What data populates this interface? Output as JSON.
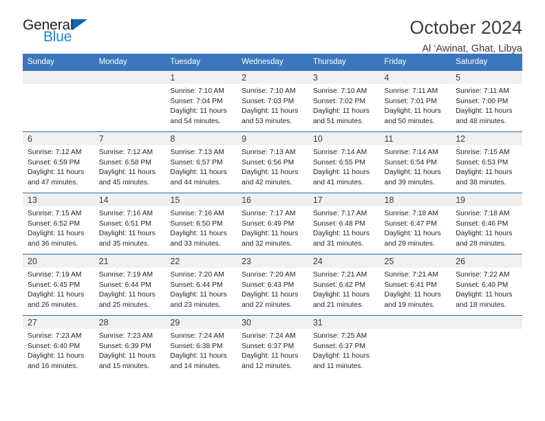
{
  "brand": {
    "name_part1": "General",
    "name_part2": "Blue",
    "flag_color": "#0b68b3",
    "text_color": "#1f85d0"
  },
  "header": {
    "title": "October 2024",
    "location": "Al ‘Awinat, Ghat, Libya"
  },
  "theme": {
    "header_bg": "#3b77bd",
    "row_border": "#1f6cb0",
    "daynum_bg": "#f0f0f0"
  },
  "weekday_headers": [
    "Sunday",
    "Monday",
    "Tuesday",
    "Wednesday",
    "Thursday",
    "Friday",
    "Saturday"
  ],
  "labels": {
    "sunrise_prefix": "Sunrise:",
    "sunset_prefix": "Sunset:",
    "daylight_prefix": "Daylight:"
  },
  "weeks": [
    [
      {
        "day": "",
        "sunrise": "",
        "sunset": "",
        "daylight_line1": "",
        "daylight_line2": ""
      },
      {
        "day": "",
        "sunrise": "",
        "sunset": "",
        "daylight_line1": "",
        "daylight_line2": ""
      },
      {
        "day": "1",
        "sunrise": "Sunrise: 7:10 AM",
        "sunset": "Sunset: 7:04 PM",
        "daylight_line1": "Daylight: 11 hours",
        "daylight_line2": "and 54 minutes."
      },
      {
        "day": "2",
        "sunrise": "Sunrise: 7:10 AM",
        "sunset": "Sunset: 7:03 PM",
        "daylight_line1": "Daylight: 11 hours",
        "daylight_line2": "and 53 minutes."
      },
      {
        "day": "3",
        "sunrise": "Sunrise: 7:10 AM",
        "sunset": "Sunset: 7:02 PM",
        "daylight_line1": "Daylight: 11 hours",
        "daylight_line2": "and 51 minutes."
      },
      {
        "day": "4",
        "sunrise": "Sunrise: 7:11 AM",
        "sunset": "Sunset: 7:01 PM",
        "daylight_line1": "Daylight: 11 hours",
        "daylight_line2": "and 50 minutes."
      },
      {
        "day": "5",
        "sunrise": "Sunrise: 7:11 AM",
        "sunset": "Sunset: 7:00 PM",
        "daylight_line1": "Daylight: 11 hours",
        "daylight_line2": "and 48 minutes."
      }
    ],
    [
      {
        "day": "6",
        "sunrise": "Sunrise: 7:12 AM",
        "sunset": "Sunset: 6:59 PM",
        "daylight_line1": "Daylight: 11 hours",
        "daylight_line2": "and 47 minutes."
      },
      {
        "day": "7",
        "sunrise": "Sunrise: 7:12 AM",
        "sunset": "Sunset: 6:58 PM",
        "daylight_line1": "Daylight: 11 hours",
        "daylight_line2": "and 45 minutes."
      },
      {
        "day": "8",
        "sunrise": "Sunrise: 7:13 AM",
        "sunset": "Sunset: 6:57 PM",
        "daylight_line1": "Daylight: 11 hours",
        "daylight_line2": "and 44 minutes."
      },
      {
        "day": "9",
        "sunrise": "Sunrise: 7:13 AM",
        "sunset": "Sunset: 6:56 PM",
        "daylight_line1": "Daylight: 11 hours",
        "daylight_line2": "and 42 minutes."
      },
      {
        "day": "10",
        "sunrise": "Sunrise: 7:14 AM",
        "sunset": "Sunset: 6:55 PM",
        "daylight_line1": "Daylight: 11 hours",
        "daylight_line2": "and 41 minutes."
      },
      {
        "day": "11",
        "sunrise": "Sunrise: 7:14 AM",
        "sunset": "Sunset: 6:54 PM",
        "daylight_line1": "Daylight: 11 hours",
        "daylight_line2": "and 39 minutes."
      },
      {
        "day": "12",
        "sunrise": "Sunrise: 7:15 AM",
        "sunset": "Sunset: 6:53 PM",
        "daylight_line1": "Daylight: 11 hours",
        "daylight_line2": "and 38 minutes."
      }
    ],
    [
      {
        "day": "13",
        "sunrise": "Sunrise: 7:15 AM",
        "sunset": "Sunset: 6:52 PM",
        "daylight_line1": "Daylight: 11 hours",
        "daylight_line2": "and 36 minutes."
      },
      {
        "day": "14",
        "sunrise": "Sunrise: 7:16 AM",
        "sunset": "Sunset: 6:51 PM",
        "daylight_line1": "Daylight: 11 hours",
        "daylight_line2": "and 35 minutes."
      },
      {
        "day": "15",
        "sunrise": "Sunrise: 7:16 AM",
        "sunset": "Sunset: 6:50 PM",
        "daylight_line1": "Daylight: 11 hours",
        "daylight_line2": "and 33 minutes."
      },
      {
        "day": "16",
        "sunrise": "Sunrise: 7:17 AM",
        "sunset": "Sunset: 6:49 PM",
        "daylight_line1": "Daylight: 11 hours",
        "daylight_line2": "and 32 minutes."
      },
      {
        "day": "17",
        "sunrise": "Sunrise: 7:17 AM",
        "sunset": "Sunset: 6:48 PM",
        "daylight_line1": "Daylight: 11 hours",
        "daylight_line2": "and 31 minutes."
      },
      {
        "day": "18",
        "sunrise": "Sunrise: 7:18 AM",
        "sunset": "Sunset: 6:47 PM",
        "daylight_line1": "Daylight: 11 hours",
        "daylight_line2": "and 29 minutes."
      },
      {
        "day": "19",
        "sunrise": "Sunrise: 7:18 AM",
        "sunset": "Sunset: 6:46 PM",
        "daylight_line1": "Daylight: 11 hours",
        "daylight_line2": "and 28 minutes."
      }
    ],
    [
      {
        "day": "20",
        "sunrise": "Sunrise: 7:19 AM",
        "sunset": "Sunset: 6:45 PM",
        "daylight_line1": "Daylight: 11 hours",
        "daylight_line2": "and 26 minutes."
      },
      {
        "day": "21",
        "sunrise": "Sunrise: 7:19 AM",
        "sunset": "Sunset: 6:44 PM",
        "daylight_line1": "Daylight: 11 hours",
        "daylight_line2": "and 25 minutes."
      },
      {
        "day": "22",
        "sunrise": "Sunrise: 7:20 AM",
        "sunset": "Sunset: 6:44 PM",
        "daylight_line1": "Daylight: 11 hours",
        "daylight_line2": "and 23 minutes."
      },
      {
        "day": "23",
        "sunrise": "Sunrise: 7:20 AM",
        "sunset": "Sunset: 6:43 PM",
        "daylight_line1": "Daylight: 11 hours",
        "daylight_line2": "and 22 minutes."
      },
      {
        "day": "24",
        "sunrise": "Sunrise: 7:21 AM",
        "sunset": "Sunset: 6:42 PM",
        "daylight_line1": "Daylight: 11 hours",
        "daylight_line2": "and 21 minutes."
      },
      {
        "day": "25",
        "sunrise": "Sunrise: 7:21 AM",
        "sunset": "Sunset: 6:41 PM",
        "daylight_line1": "Daylight: 11 hours",
        "daylight_line2": "and 19 minutes."
      },
      {
        "day": "26",
        "sunrise": "Sunrise: 7:22 AM",
        "sunset": "Sunset: 6:40 PM",
        "daylight_line1": "Daylight: 11 hours",
        "daylight_line2": "and 18 minutes."
      }
    ],
    [
      {
        "day": "27",
        "sunrise": "Sunrise: 7:23 AM",
        "sunset": "Sunset: 6:40 PM",
        "daylight_line1": "Daylight: 11 hours",
        "daylight_line2": "and 16 minutes."
      },
      {
        "day": "28",
        "sunrise": "Sunrise: 7:23 AM",
        "sunset": "Sunset: 6:39 PM",
        "daylight_line1": "Daylight: 11 hours",
        "daylight_line2": "and 15 minutes."
      },
      {
        "day": "29",
        "sunrise": "Sunrise: 7:24 AM",
        "sunset": "Sunset: 6:38 PM",
        "daylight_line1": "Daylight: 11 hours",
        "daylight_line2": "and 14 minutes."
      },
      {
        "day": "30",
        "sunrise": "Sunrise: 7:24 AM",
        "sunset": "Sunset: 6:37 PM",
        "daylight_line1": "Daylight: 11 hours",
        "daylight_line2": "and 12 minutes."
      },
      {
        "day": "31",
        "sunrise": "Sunrise: 7:25 AM",
        "sunset": "Sunset: 6:37 PM",
        "daylight_line1": "Daylight: 11 hours",
        "daylight_line2": "and 11 minutes."
      },
      {
        "day": "",
        "sunrise": "",
        "sunset": "",
        "daylight_line1": "",
        "daylight_line2": ""
      },
      {
        "day": "",
        "sunrise": "",
        "sunset": "",
        "daylight_line1": "",
        "daylight_line2": ""
      }
    ]
  ]
}
